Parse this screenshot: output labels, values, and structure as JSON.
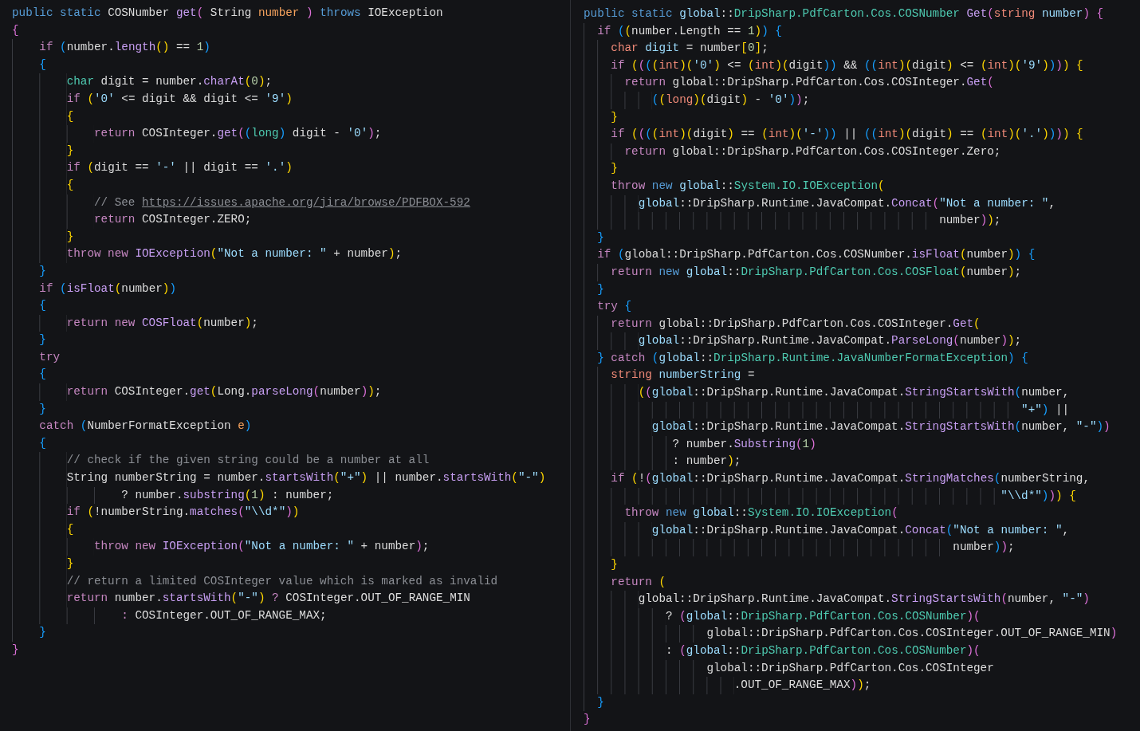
{
  "panes": [
    {
      "lines": [
        [
          {
            "text": "public static ",
            "kind": "kw"
          },
          {
            "text": "COSNumber ",
            "kind": "txt"
          },
          {
            "text": "get",
            "kind": "fn"
          },
          {
            "text": "( ",
            "kind": "b2"
          },
          {
            "text": "String ",
            "kind": "txt"
          },
          {
            "text": "number",
            "kind": "par"
          },
          {
            "text": " ) ",
            "kind": "b2"
          },
          {
            "text": "throws ",
            "kind": "kw"
          },
          {
            "text": "IOException",
            "kind": "txt"
          }
        ],
        [
          {
            "text": "{",
            "kind": "b2"
          }
        ],
        [
          {
            "text": "    if ",
            "kind": "ctl"
          },
          {
            "text": "(",
            "kind": "b3"
          },
          {
            "text": "number.",
            "kind": "txt"
          },
          {
            "text": "length",
            "kind": "fn"
          },
          {
            "text": "()",
            "kind": "b1"
          },
          {
            "text": " == ",
            "kind": "txt"
          },
          {
            "text": "1",
            "kind": "num"
          },
          {
            "text": ")",
            "kind": "b3"
          }
        ],
        [
          {
            "text": "    {",
            "kind": "b3"
          }
        ],
        [
          {
            "text": "        char",
            "kind": "ty"
          },
          {
            "text": " digit = number.",
            "kind": "txt"
          },
          {
            "text": "charAt",
            "kind": "fn"
          },
          {
            "text": "(",
            "kind": "b1"
          },
          {
            "text": "0",
            "kind": "num"
          },
          {
            "text": ")",
            "kind": "b1"
          },
          {
            "text": ";",
            "kind": "txt"
          }
        ],
        [
          {
            "text": "        if ",
            "kind": "ctl"
          },
          {
            "text": "(",
            "kind": "b1"
          },
          {
            "text": "'0'",
            "kind": "str"
          },
          {
            "text": " <= digit && digit <= ",
            "kind": "txt"
          },
          {
            "text": "'9'",
            "kind": "str"
          },
          {
            "text": ")",
            "kind": "b1"
          }
        ],
        [
          {
            "text": "        {",
            "kind": "b1"
          }
        ],
        [
          {
            "text": "            return ",
            "kind": "ctl"
          },
          {
            "text": "COSInteger.",
            "kind": "txt"
          },
          {
            "text": "get",
            "kind": "fn"
          },
          {
            "text": "(",
            "kind": "b2"
          },
          {
            "text": "(",
            "kind": "b3"
          },
          {
            "text": "long",
            "kind": "ty"
          },
          {
            "text": ")",
            "kind": "b3"
          },
          {
            "text": " digit - ",
            "kind": "txt"
          },
          {
            "text": "'0'",
            "kind": "str"
          },
          {
            "text": ")",
            "kind": "b2"
          },
          {
            "text": ";",
            "kind": "txt"
          }
        ],
        [
          {
            "text": "        }",
            "kind": "b1"
          }
        ],
        [
          {
            "text": "        if ",
            "kind": "ctl"
          },
          {
            "text": "(",
            "kind": "b1"
          },
          {
            "text": "digit == ",
            "kind": "txt"
          },
          {
            "text": "'-'",
            "kind": "str"
          },
          {
            "text": " || digit == ",
            "kind": "txt"
          },
          {
            "text": "'.'",
            "kind": "str"
          },
          {
            "text": ")",
            "kind": "b1"
          }
        ],
        [
          {
            "text": "        {",
            "kind": "b1"
          }
        ],
        [
          {
            "text": "            // See ",
            "kind": "com"
          },
          {
            "text": "https://issues.apache.org/jira/browse/PDFBOX-592",
            "kind": "link"
          }
        ],
        [
          {
            "text": "            return ",
            "kind": "ctl"
          },
          {
            "text": "COSInteger.ZERO;",
            "kind": "txt"
          }
        ],
        [
          {
            "text": "        }",
            "kind": "b1"
          }
        ],
        [
          {
            "text": "        throw new ",
            "kind": "ctl"
          },
          {
            "text": "IOException",
            "kind": "fn"
          },
          {
            "text": "(",
            "kind": "b1"
          },
          {
            "text": "\"Not a number: \"",
            "kind": "str"
          },
          {
            "text": " + number",
            "kind": "txt"
          },
          {
            "text": ")",
            "kind": "b1"
          },
          {
            "text": ";",
            "kind": "txt"
          }
        ],
        [
          {
            "text": "    }",
            "kind": "b3"
          }
        ],
        [
          {
            "text": "    if ",
            "kind": "ctl"
          },
          {
            "text": "(",
            "kind": "b3"
          },
          {
            "text": "isFloat",
            "kind": "fn"
          },
          {
            "text": "(",
            "kind": "b1"
          },
          {
            "text": "number",
            "kind": "txt"
          },
          {
            "text": ")",
            "kind": "b1"
          },
          {
            "text": ")",
            "kind": "b3"
          }
        ],
        [
          {
            "text": "    {",
            "kind": "b3"
          }
        ],
        [
          {
            "text": "        return new ",
            "kind": "ctl"
          },
          {
            "text": "COSFloat",
            "kind": "fn"
          },
          {
            "text": "(",
            "kind": "b1"
          },
          {
            "text": "number",
            "kind": "txt"
          },
          {
            "text": ")",
            "kind": "b1"
          },
          {
            "text": ";",
            "kind": "txt"
          }
        ],
        [
          {
            "text": "    }",
            "kind": "b3"
          }
        ],
        [
          {
            "text": "    try",
            "kind": "ctl"
          }
        ],
        [
          {
            "text": "    {",
            "kind": "b3"
          }
        ],
        [
          {
            "text": "        return ",
            "kind": "ctl"
          },
          {
            "text": "COSInteger.",
            "kind": "txt"
          },
          {
            "text": "get",
            "kind": "fn"
          },
          {
            "text": "(",
            "kind": "b1"
          },
          {
            "text": "Long.",
            "kind": "txt"
          },
          {
            "text": "parseLong",
            "kind": "fn"
          },
          {
            "text": "(",
            "kind": "b2"
          },
          {
            "text": "number",
            "kind": "txt"
          },
          {
            "text": ")",
            "kind": "b2"
          },
          {
            "text": ")",
            "kind": "b1"
          },
          {
            "text": ";",
            "kind": "txt"
          }
        ],
        [
          {
            "text": "    }",
            "kind": "b3"
          }
        ],
        [
          {
            "text": "    catch ",
            "kind": "ctl"
          },
          {
            "text": "(",
            "kind": "b3"
          },
          {
            "text": "NumberFormatException ",
            "kind": "txt"
          },
          {
            "text": "e",
            "kind": "par"
          },
          {
            "text": ")",
            "kind": "b3"
          }
        ],
        [
          {
            "text": "    {",
            "kind": "b3"
          }
        ],
        [
          {
            "text": "        // check if the given string could be a number at all",
            "kind": "com"
          }
        ],
        [
          {
            "text": "        String numberString = number.",
            "kind": "txt"
          },
          {
            "text": "startsWith",
            "kind": "fn"
          },
          {
            "text": "(",
            "kind": "b1"
          },
          {
            "text": "\"+\"",
            "kind": "str"
          },
          {
            "text": ")",
            "kind": "b1"
          },
          {
            "text": " || number.",
            "kind": "txt"
          },
          {
            "text": "startsWith",
            "kind": "fn"
          },
          {
            "text": "(",
            "kind": "b1"
          },
          {
            "text": "\"-\"",
            "kind": "str"
          },
          {
            "text": ")",
            "kind": "b1"
          }
        ],
        [
          {
            "text": "                ? number.",
            "kind": "txt"
          },
          {
            "text": "substring",
            "kind": "fn"
          },
          {
            "text": "(",
            "kind": "b1"
          },
          {
            "text": "1",
            "kind": "num"
          },
          {
            "text": ")",
            "kind": "b1"
          },
          {
            "text": " : number;",
            "kind": "txt"
          }
        ],
        [
          {
            "text": "        if ",
            "kind": "ctl"
          },
          {
            "text": "(",
            "kind": "b1"
          },
          {
            "text": "!numberString.",
            "kind": "txt"
          },
          {
            "text": "matches",
            "kind": "fn"
          },
          {
            "text": "(",
            "kind": "b2"
          },
          {
            "text": "\"\\\\d*\"",
            "kind": "str"
          },
          {
            "text": ")",
            "kind": "b2"
          },
          {
            "text": ")",
            "kind": "b1"
          }
        ],
        [
          {
            "text": "        {",
            "kind": "b1"
          }
        ],
        [
          {
            "text": "            throw new ",
            "kind": "ctl"
          },
          {
            "text": "IOException",
            "kind": "fn"
          },
          {
            "text": "(",
            "kind": "b2"
          },
          {
            "text": "\"Not a number: \"",
            "kind": "str"
          },
          {
            "text": " + number",
            "kind": "txt"
          },
          {
            "text": ")",
            "kind": "b2"
          },
          {
            "text": ";",
            "kind": "txt"
          }
        ],
        [
          {
            "text": "        }",
            "kind": "b1"
          }
        ],
        [
          {
            "text": "        // return a limited COSInteger value which is marked as invalid",
            "kind": "com"
          }
        ],
        [
          {
            "text": "        return ",
            "kind": "ctl"
          },
          {
            "text": "number.",
            "kind": "txt"
          },
          {
            "text": "startsWith",
            "kind": "fn"
          },
          {
            "text": "(",
            "kind": "b1"
          },
          {
            "text": "\"-\"",
            "kind": "str"
          },
          {
            "text": ")",
            "kind": "b1"
          },
          {
            "text": " ? ",
            "kind": "ctl"
          },
          {
            "text": "COSInteger.OUT_OF_RANGE_MIN",
            "kind": "txt"
          }
        ],
        [
          {
            "text": "                : ",
            "kind": "ctl"
          },
          {
            "text": "COSInteger.OUT_OF_RANGE_MAX;",
            "kind": "txt"
          }
        ],
        [
          {
            "text": "    }",
            "kind": "b3"
          }
        ],
        [
          {
            "text": "}",
            "kind": "b2"
          }
        ]
      ]
    },
    {
      "lines": [
        [
          {
            "text": "public static ",
            "kind": "kw"
          },
          {
            "text": "global",
            "kind": "var"
          },
          {
            "text": "::",
            "kind": "txt"
          },
          {
            "text": "DripSharp.PdfCarton.Cos.COSNumber",
            "kind": "ty"
          },
          {
            "text": " Get",
            "kind": "fn"
          },
          {
            "text": "(",
            "kind": "b2"
          },
          {
            "text": "string",
            "kind": "prim"
          },
          {
            "text": " number",
            "kind": "var"
          },
          {
            "text": ") {",
            "kind": "b2"
          }
        ],
        [
          {
            "text": "  if ",
            "kind": "ctl"
          },
          {
            "text": "(",
            "kind": "b3"
          },
          {
            "text": "(",
            "kind": "b1"
          },
          {
            "text": "number.Length == ",
            "kind": "txt"
          },
          {
            "text": "1",
            "kind": "num"
          },
          {
            "text": ")",
            "kind": "b1"
          },
          {
            "text": ") {",
            "kind": "b3"
          }
        ],
        [
          {
            "text": "    char",
            "kind": "prim"
          },
          {
            "text": " digit",
            "kind": "var"
          },
          {
            "text": " = number",
            "kind": "txt"
          },
          {
            "text": "[",
            "kind": "b1"
          },
          {
            "text": "0",
            "kind": "num"
          },
          {
            "text": "]",
            "kind": "b1"
          },
          {
            "text": ";",
            "kind": "txt"
          }
        ],
        [
          {
            "text": "    if ",
            "kind": "ctl"
          },
          {
            "text": "(",
            "kind": "b1"
          },
          {
            "text": "(",
            "kind": "b2"
          },
          {
            "text": "(",
            "kind": "b3"
          },
          {
            "text": "(",
            "kind": "b1"
          },
          {
            "text": "int",
            "kind": "prim"
          },
          {
            "text": ")(",
            "kind": "b1"
          },
          {
            "text": "'0'",
            "kind": "str"
          },
          {
            "text": ")",
            "kind": "b1"
          },
          {
            "text": " <= ",
            "kind": "txt"
          },
          {
            "text": "(",
            "kind": "b1"
          },
          {
            "text": "int",
            "kind": "prim"
          },
          {
            "text": ")(",
            "kind": "b1"
          },
          {
            "text": "digit",
            "kind": "txt"
          },
          {
            "text": "))",
            "kind": "b3"
          },
          {
            "text": " && ",
            "kind": "txt"
          },
          {
            "text": "((",
            "kind": "b3"
          },
          {
            "text": "int",
            "kind": "prim"
          },
          {
            "text": ")(",
            "kind": "b1"
          },
          {
            "text": "digit",
            "kind": "txt"
          },
          {
            "text": ")",
            "kind": "b1"
          },
          {
            "text": " <= ",
            "kind": "txt"
          },
          {
            "text": "(",
            "kind": "b1"
          },
          {
            "text": "int",
            "kind": "prim"
          },
          {
            "text": ")(",
            "kind": "b1"
          },
          {
            "text": "'9'",
            "kind": "str"
          },
          {
            "text": ")",
            "kind": "b1"
          },
          {
            "text": ")",
            "kind": "b3"
          },
          {
            "text": ")",
            "kind": "b2"
          },
          {
            "text": ") {",
            "kind": "b1"
          }
        ],
        [
          {
            "text": "      return ",
            "kind": "ctl"
          },
          {
            "text": "global::DripSharp.PdfCarton.Cos.COSInteger.",
            "kind": "txt"
          },
          {
            "text": "Get",
            "kind": "fn"
          },
          {
            "text": "(",
            "kind": "b2"
          }
        ],
        [
          {
            "text": "          (",
            "kind": "b3"
          },
          {
            "text": "(",
            "kind": "b1"
          },
          {
            "text": "long",
            "kind": "prim"
          },
          {
            "text": ")(",
            "kind": "b1"
          },
          {
            "text": "digit",
            "kind": "txt"
          },
          {
            "text": ")",
            "kind": "b1"
          },
          {
            "text": " - ",
            "kind": "txt"
          },
          {
            "text": "'0'",
            "kind": "str"
          },
          {
            "text": ")",
            "kind": "b3"
          },
          {
            "text": ")",
            "kind": "b2"
          },
          {
            "text": ";",
            "kind": "txt"
          }
        ],
        [
          {
            "text": "    }",
            "kind": "b1"
          }
        ],
        [
          {
            "text": "    if ",
            "kind": "ctl"
          },
          {
            "text": "(",
            "kind": "b1"
          },
          {
            "text": "(",
            "kind": "b2"
          },
          {
            "text": "(",
            "kind": "b3"
          },
          {
            "text": "(",
            "kind": "b1"
          },
          {
            "text": "int",
            "kind": "prim"
          },
          {
            "text": ")(",
            "kind": "b1"
          },
          {
            "text": "digit",
            "kind": "txt"
          },
          {
            "text": ")",
            "kind": "b1"
          },
          {
            "text": " == ",
            "kind": "txt"
          },
          {
            "text": "(",
            "kind": "b1"
          },
          {
            "text": "int",
            "kind": "prim"
          },
          {
            "text": ")(",
            "kind": "b1"
          },
          {
            "text": "'-'",
            "kind": "str"
          },
          {
            "text": "))",
            "kind": "b3"
          },
          {
            "text": " || ",
            "kind": "txt"
          },
          {
            "text": "((",
            "kind": "b3"
          },
          {
            "text": "int",
            "kind": "prim"
          },
          {
            "text": ")(",
            "kind": "b1"
          },
          {
            "text": "digit",
            "kind": "txt"
          },
          {
            "text": ")",
            "kind": "b1"
          },
          {
            "text": " == ",
            "kind": "txt"
          },
          {
            "text": "(",
            "kind": "b1"
          },
          {
            "text": "int",
            "kind": "prim"
          },
          {
            "text": ")(",
            "kind": "b1"
          },
          {
            "text": "'.'",
            "kind": "str"
          },
          {
            "text": ")",
            "kind": "b1"
          },
          {
            "text": ")",
            "kind": "b3"
          },
          {
            "text": ")",
            "kind": "b2"
          },
          {
            "text": ") {",
            "kind": "b1"
          }
        ],
        [
          {
            "text": "      return ",
            "kind": "ctl"
          },
          {
            "text": "global::DripSharp.PdfCarton.Cos.COSInteger.Zero;",
            "kind": "txt"
          }
        ],
        [
          {
            "text": "    }",
            "kind": "b1"
          }
        ],
        [
          {
            "text": "    throw",
            "kind": "ctl"
          },
          {
            "text": " new ",
            "kind": "kw"
          },
          {
            "text": "global",
            "kind": "var"
          },
          {
            "text": "::",
            "kind": "txt"
          },
          {
            "text": "System.IO.IOException",
            "kind": "ty"
          },
          {
            "text": "(",
            "kind": "b1"
          }
        ],
        [
          {
            "text": "        global",
            "kind": "var"
          },
          {
            "text": "::DripSharp.Runtime.JavaCompat.",
            "kind": "txt"
          },
          {
            "text": "Concat",
            "kind": "fn"
          },
          {
            "text": "(",
            "kind": "b2"
          },
          {
            "text": "\"Not a number: \"",
            "kind": "str"
          },
          {
            "text": ",",
            "kind": "txt"
          }
        ],
        [
          {
            "text": "                                                    number",
            "kind": "txt"
          },
          {
            "text": ")",
            "kind": "b2"
          },
          {
            "text": ")",
            "kind": "b1"
          },
          {
            "text": ";",
            "kind": "txt"
          }
        ],
        [
          {
            "text": "  }",
            "kind": "b3"
          }
        ],
        [
          {
            "text": "  if ",
            "kind": "ctl"
          },
          {
            "text": "(",
            "kind": "b3"
          },
          {
            "text": "global::DripSharp.PdfCarton.Cos.COSNumber.",
            "kind": "txt"
          },
          {
            "text": "isFloat",
            "kind": "fn"
          },
          {
            "text": "(",
            "kind": "b1"
          },
          {
            "text": "number",
            "kind": "txt"
          },
          {
            "text": ")",
            "kind": "b1"
          },
          {
            "text": ") {",
            "kind": "b3"
          }
        ],
        [
          {
            "text": "    return",
            "kind": "ctl"
          },
          {
            "text": " new ",
            "kind": "kw"
          },
          {
            "text": "global",
            "kind": "var"
          },
          {
            "text": "::",
            "kind": "txt"
          },
          {
            "text": "DripSharp.PdfCarton.Cos.COSFloat",
            "kind": "ty"
          },
          {
            "text": "(",
            "kind": "b1"
          },
          {
            "text": "number",
            "kind": "txt"
          },
          {
            "text": ")",
            "kind": "b1"
          },
          {
            "text": ";",
            "kind": "txt"
          }
        ],
        [
          {
            "text": "  }",
            "kind": "b3"
          }
        ],
        [
          {
            "text": "  try ",
            "kind": "ctl"
          },
          {
            "text": "{",
            "kind": "b3"
          }
        ],
        [
          {
            "text": "    return ",
            "kind": "ctl"
          },
          {
            "text": "global::DripSharp.PdfCarton.Cos.COSInteger.",
            "kind": "txt"
          },
          {
            "text": "Get",
            "kind": "fn"
          },
          {
            "text": "(",
            "kind": "b1"
          }
        ],
        [
          {
            "text": "        global",
            "kind": "var"
          },
          {
            "text": "::DripSharp.Runtime.JavaCompat.",
            "kind": "txt"
          },
          {
            "text": "ParseLong",
            "kind": "fn"
          },
          {
            "text": "(",
            "kind": "b2"
          },
          {
            "text": "number",
            "kind": "txt"
          },
          {
            "text": ")",
            "kind": "b2"
          },
          {
            "text": ")",
            "kind": "b1"
          },
          {
            "text": ";",
            "kind": "txt"
          }
        ],
        [
          {
            "text": "  }",
            "kind": "b3"
          },
          {
            "text": " catch ",
            "kind": "ctl"
          },
          {
            "text": "(",
            "kind": "b3"
          },
          {
            "text": "global",
            "kind": "var"
          },
          {
            "text": "::",
            "kind": "txt"
          },
          {
            "text": "DripSharp.Runtime.JavaNumberFormatException",
            "kind": "ty"
          },
          {
            "text": ") {",
            "kind": "b3"
          }
        ],
        [
          {
            "text": "    string",
            "kind": "prim"
          },
          {
            "text": " numberString",
            "kind": "var"
          },
          {
            "text": " =",
            "kind": "txt"
          }
        ],
        [
          {
            "text": "        (",
            "kind": "b1"
          },
          {
            "text": "(",
            "kind": "b2"
          },
          {
            "text": "global",
            "kind": "var"
          },
          {
            "text": "::DripSharp.Runtime.JavaCompat.",
            "kind": "txt"
          },
          {
            "text": "StringStartsWith",
            "kind": "fn"
          },
          {
            "text": "(",
            "kind": "b3"
          },
          {
            "text": "number,",
            "kind": "txt"
          }
        ],
        [
          {
            "text": "                                                                \"+\"",
            "kind": "str"
          },
          {
            "text": ")",
            "kind": "b3"
          },
          {
            "text": " ||",
            "kind": "txt"
          }
        ],
        [
          {
            "text": "          global",
            "kind": "var"
          },
          {
            "text": "::DripSharp.Runtime.JavaCompat.",
            "kind": "txt"
          },
          {
            "text": "StringStartsWith",
            "kind": "fn"
          },
          {
            "text": "(",
            "kind": "b3"
          },
          {
            "text": "number, ",
            "kind": "txt"
          },
          {
            "text": "\"-\"",
            "kind": "str"
          },
          {
            "text": ")",
            "kind": "b3"
          },
          {
            "text": ")",
            "kind": "b2"
          }
        ],
        [
          {
            "text": "             ? number.",
            "kind": "txt"
          },
          {
            "text": "Substring",
            "kind": "fn"
          },
          {
            "text": "(",
            "kind": "b2"
          },
          {
            "text": "1",
            "kind": "num"
          },
          {
            "text": ")",
            "kind": "b2"
          }
        ],
        [
          {
            "text": "             : number",
            "kind": "txt"
          },
          {
            "text": ")",
            "kind": "b1"
          },
          {
            "text": ";",
            "kind": "txt"
          }
        ],
        [
          {
            "text": "    if ",
            "kind": "ctl"
          },
          {
            "text": "(",
            "kind": "b1"
          },
          {
            "text": "!",
            "kind": "txt"
          },
          {
            "text": "(",
            "kind": "b2"
          },
          {
            "text": "global",
            "kind": "var"
          },
          {
            "text": "::DripSharp.Runtime.JavaCompat.",
            "kind": "txt"
          },
          {
            "text": "StringMatches",
            "kind": "fn"
          },
          {
            "text": "(",
            "kind": "b3"
          },
          {
            "text": "numberString,",
            "kind": "txt"
          }
        ],
        [
          {
            "text": "                                                             \"\\\\d*\"",
            "kind": "str"
          },
          {
            "text": ")",
            "kind": "b3"
          },
          {
            "text": ")",
            "kind": "b2"
          },
          {
            "text": ") {",
            "kind": "b1"
          }
        ],
        [
          {
            "text": "      throw",
            "kind": "ctl"
          },
          {
            "text": " new ",
            "kind": "kw"
          },
          {
            "text": "global",
            "kind": "var"
          },
          {
            "text": "::",
            "kind": "txt"
          },
          {
            "text": "System.IO.IOException",
            "kind": "ty"
          },
          {
            "text": "(",
            "kind": "b2"
          }
        ],
        [
          {
            "text": "          global",
            "kind": "var"
          },
          {
            "text": "::DripSharp.Runtime.JavaCompat.",
            "kind": "txt"
          },
          {
            "text": "Concat",
            "kind": "fn"
          },
          {
            "text": "(",
            "kind": "b3"
          },
          {
            "text": "\"Not a number: \"",
            "kind": "str"
          },
          {
            "text": ",",
            "kind": "txt"
          }
        ],
        [
          {
            "text": "                                                      number",
            "kind": "txt"
          },
          {
            "text": ")",
            "kind": "b3"
          },
          {
            "text": ")",
            "kind": "b2"
          },
          {
            "text": ";",
            "kind": "txt"
          }
        ],
        [
          {
            "text": "    }",
            "kind": "b1"
          }
        ],
        [
          {
            "text": "    return ",
            "kind": "ctl"
          },
          {
            "text": "(",
            "kind": "b1"
          }
        ],
        [
          {
            "text": "        global::DripSharp.Runtime.JavaCompat.",
            "kind": "txt"
          },
          {
            "text": "StringStartsWith",
            "kind": "fn"
          },
          {
            "text": "(",
            "kind": "b2"
          },
          {
            "text": "number, ",
            "kind": "txt"
          },
          {
            "text": "\"-\"",
            "kind": "str"
          },
          {
            "text": ")",
            "kind": "b2"
          }
        ],
        [
          {
            "text": "            ? ",
            "kind": "txt"
          },
          {
            "text": "(",
            "kind": "b2"
          },
          {
            "text": "global",
            "kind": "var"
          },
          {
            "text": "::",
            "kind": "txt"
          },
          {
            "text": "DripSharp.PdfCarton.Cos.COSNumber",
            "kind": "ty"
          },
          {
            "text": ")(",
            "kind": "b2"
          }
        ],
        [
          {
            "text": "                  global::DripSharp.PdfCarton.Cos.COSInteger.OUT_OF_RANGE_MIN",
            "kind": "txt"
          },
          {
            "text": ")",
            "kind": "b2"
          }
        ],
        [
          {
            "text": "            : ",
            "kind": "txt"
          },
          {
            "text": "(",
            "kind": "b2"
          },
          {
            "text": "global",
            "kind": "var"
          },
          {
            "text": "::",
            "kind": "txt"
          },
          {
            "text": "DripSharp.PdfCarton.Cos.COSNumber",
            "kind": "ty"
          },
          {
            "text": ")(",
            "kind": "b2"
          }
        ],
        [
          {
            "text": "                  global::DripSharp.PdfCarton.Cos.COSInteger",
            "kind": "txt"
          }
        ],
        [
          {
            "text": "                      .OUT_OF_RANGE_MAX",
            "kind": "txt"
          },
          {
            "text": ")",
            "kind": "b2"
          },
          {
            "text": ")",
            "kind": "b1"
          },
          {
            "text": ";",
            "kind": "txt"
          }
        ],
        [
          {
            "text": "  }",
            "kind": "b3"
          }
        ],
        [
          {
            "text": "}",
            "kind": "b2"
          }
        ]
      ]
    }
  ]
}
